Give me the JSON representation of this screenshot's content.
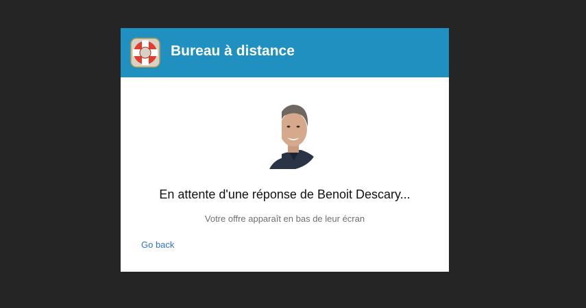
{
  "header": {
    "title": "Bureau à distance",
    "logo_icon": "lifebuoy-icon",
    "background_color": "#1f90c0"
  },
  "main": {
    "avatar_icon": "user-avatar",
    "waiting_message": "En attente d'une réponse de Benoit Descary...",
    "subtitle": "Votre offre apparaît en bas de leur écran",
    "go_back_label": "Go back",
    "link_color": "#2a71d0"
  }
}
